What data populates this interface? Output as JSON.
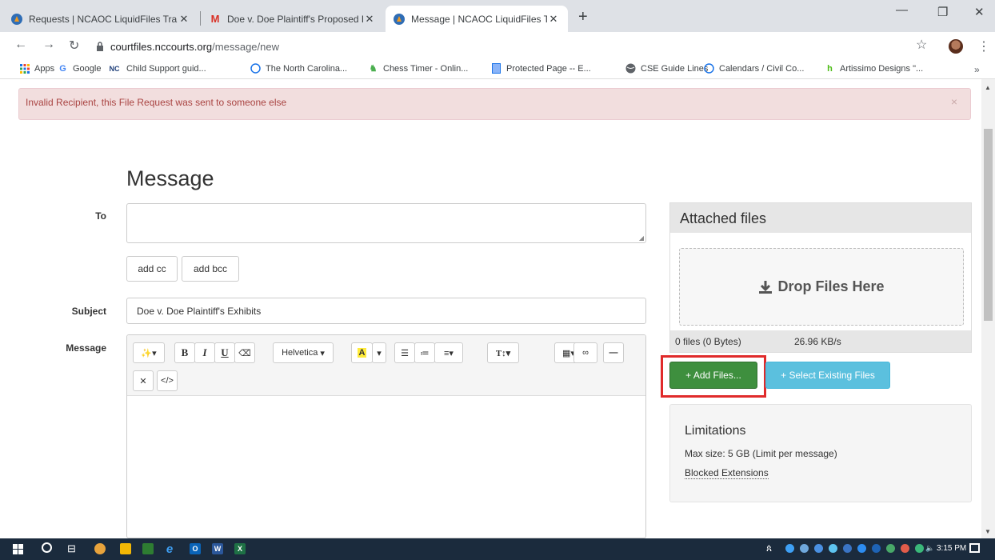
{
  "browser": {
    "tabs": [
      {
        "title": "Requests | NCAOC LiquidFiles Tra",
        "active": false
      },
      {
        "title": "Doe v. Doe Plaintiff's Proposed E",
        "active": false
      },
      {
        "title": "Message | NCAOC LiquidFiles Tra",
        "active": true
      }
    ],
    "url_host": "courtfiles.nccourts.org",
    "url_path": "/message/new",
    "bookmarks": [
      "Apps",
      "Google",
      "Child Support guid...",
      "The North Carolina...",
      "Chess Timer - Onlin...",
      "Protected Page -- E...",
      "CSE Guide Lines",
      "Calendars / Civil Co...",
      "Artissimo Designs \"..."
    ]
  },
  "alert": {
    "text": "Invalid Recipient, this File Request was sent to someone else",
    "close": "×"
  },
  "form": {
    "title": "Message",
    "to_label": "To",
    "to_value": "",
    "add_cc": "add cc",
    "add_bcc": "add bcc",
    "subject_label": "Subject",
    "subject_value": "Doe v. Doe Plaintiff's Exhibits",
    "message_label": "Message",
    "font_name": "Helvetica"
  },
  "attachments": {
    "title": "Attached files",
    "drop_text": "Drop Files Here",
    "file_count": "0 files (0 Bytes)",
    "speed": "26.96 KB/s",
    "add_files": "+ Add Files...",
    "select_existing": "+ Select Existing Files"
  },
  "limitations": {
    "title": "Limitations",
    "max_size": "Max size: 5 GB (Limit per message)",
    "blocked": "Blocked Extensions"
  },
  "taskbar": {
    "clock": "3:15 PM"
  }
}
